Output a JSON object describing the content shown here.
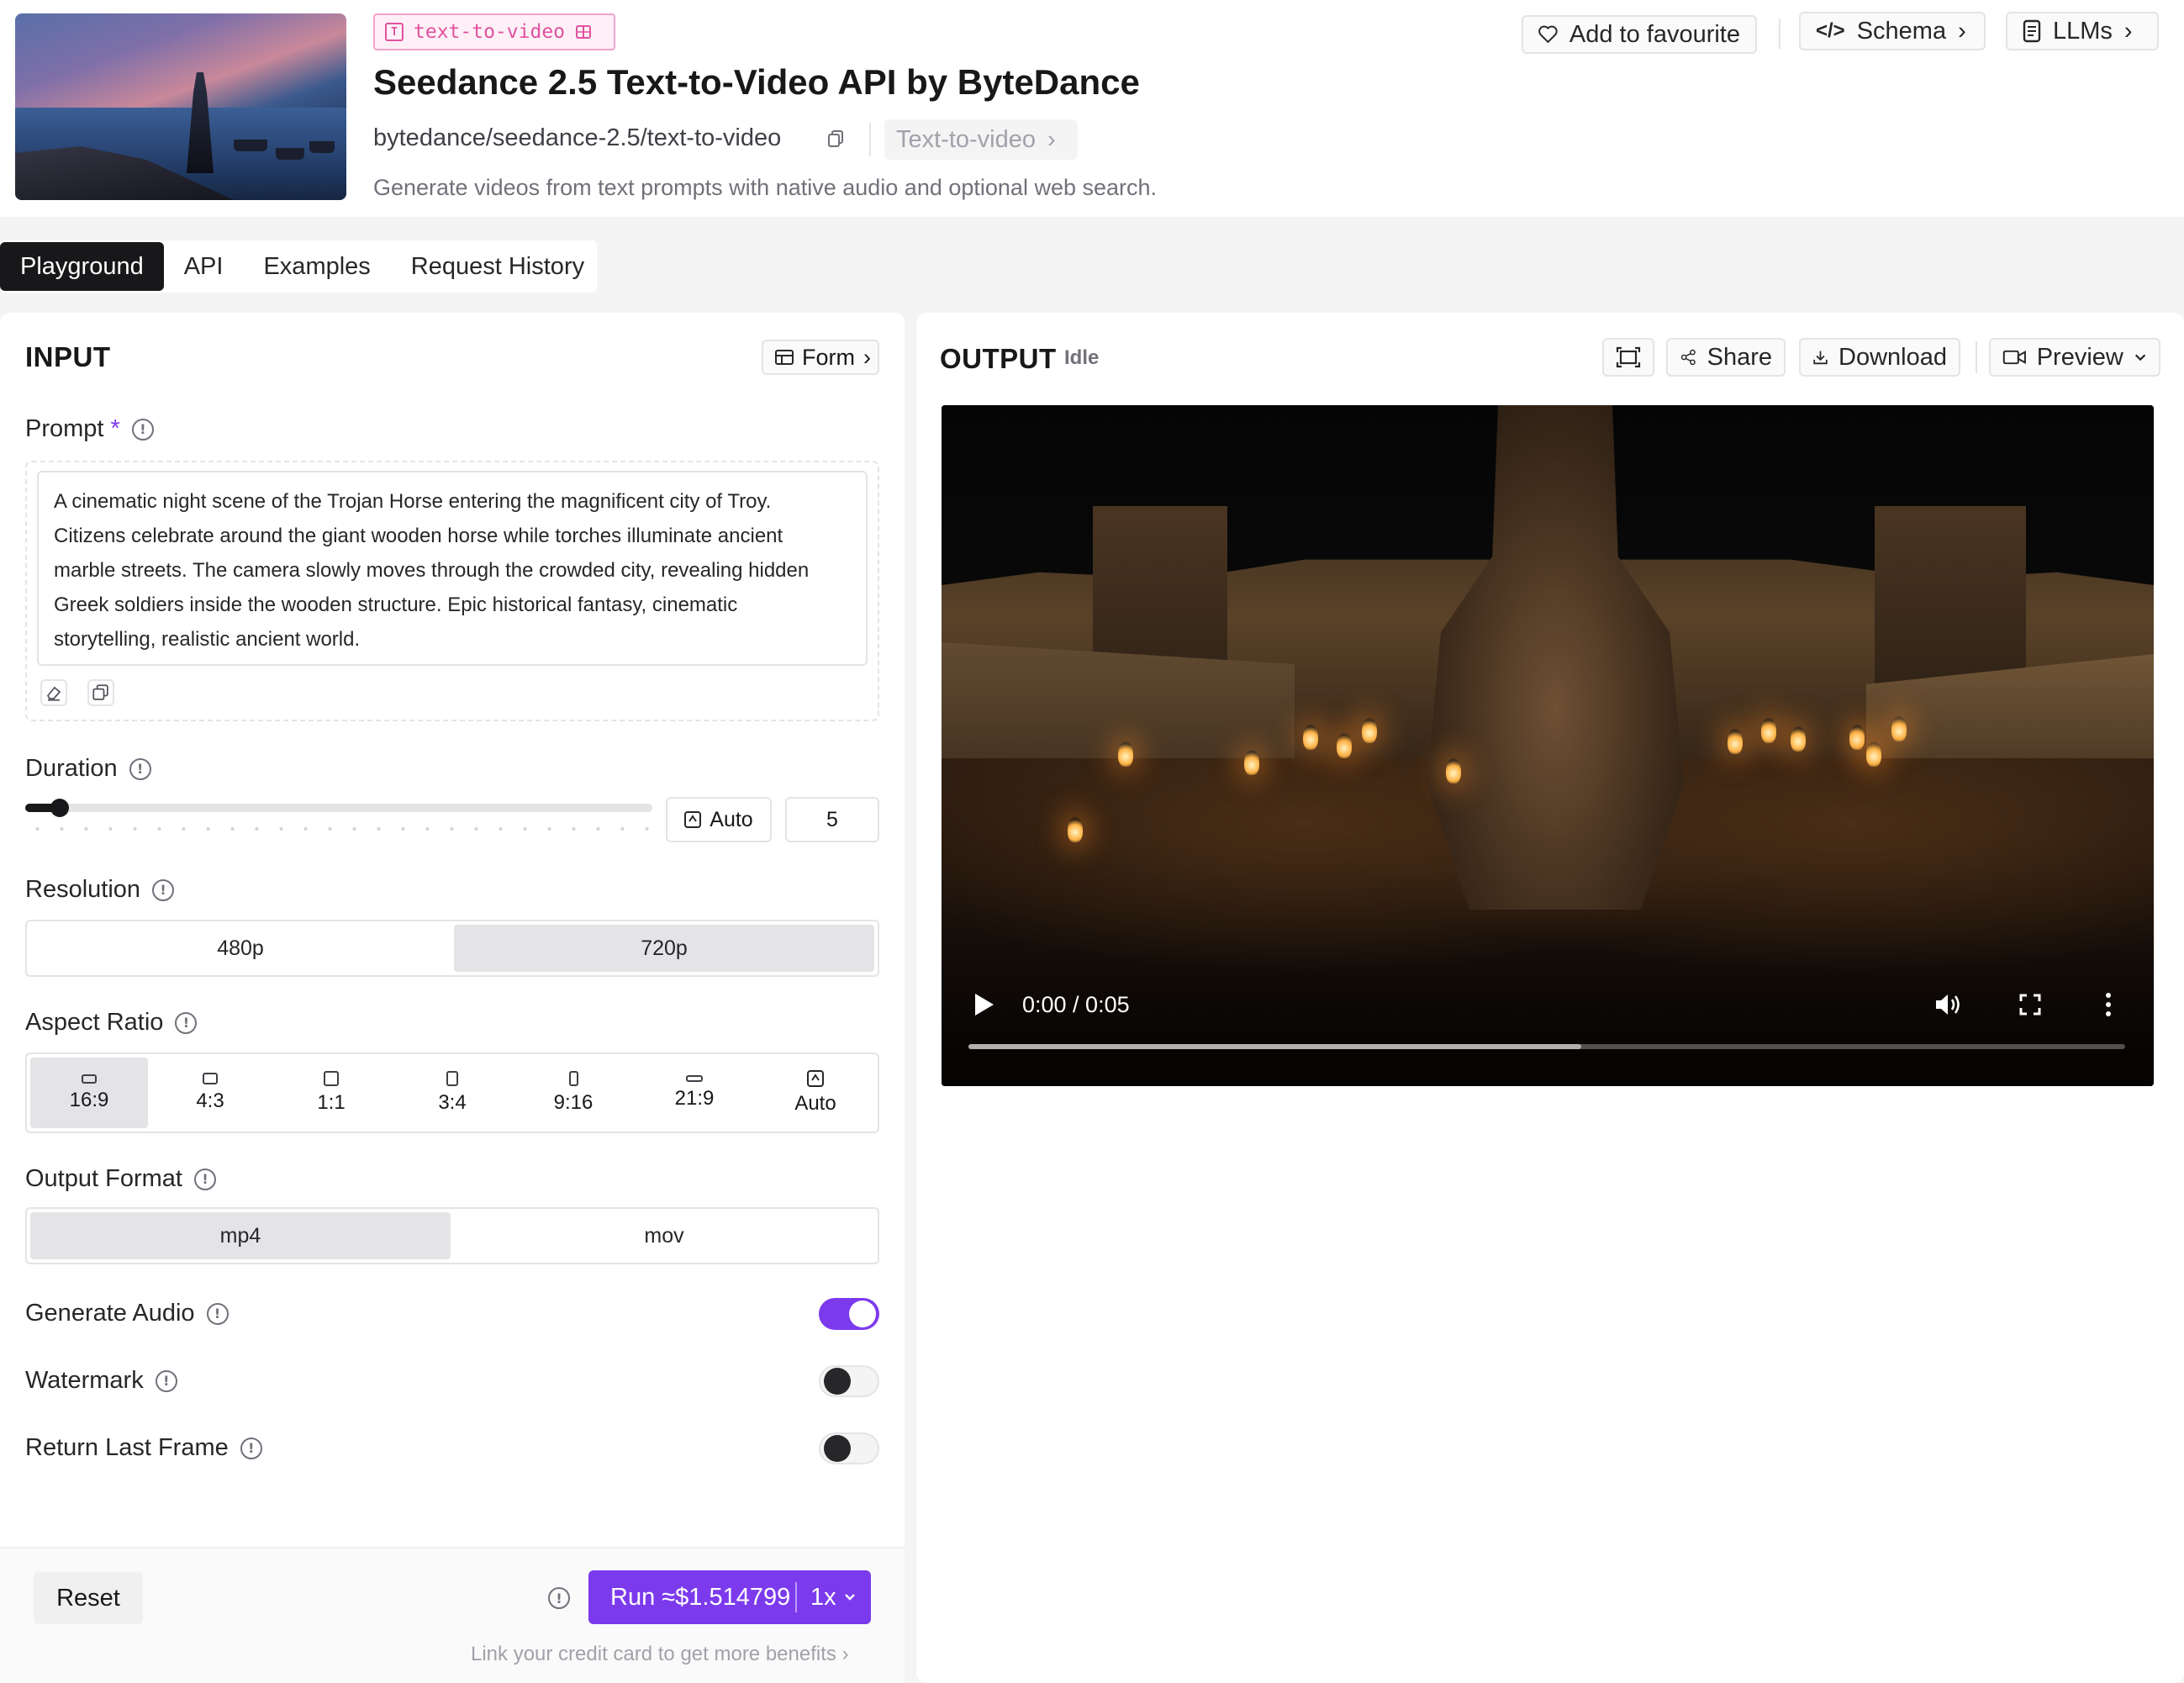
{
  "header": {
    "tag": "text-to-video",
    "title": "Seedance 2.5 Text-to-Video API by ByteDance",
    "model_id": "bytedance/seedance-2.5/text-to-video",
    "category": "Text-to-video",
    "description": "Generate videos from text prompts with native audio and optional web search.",
    "favourite_label": "Add to favourite",
    "schema_label": "Schema",
    "llms_label": "LLMs"
  },
  "tabs": [
    {
      "label": "Playground",
      "active": true
    },
    {
      "label": "API",
      "active": false
    },
    {
      "label": "Examples",
      "active": false
    },
    {
      "label": "Request History",
      "active": false
    }
  ],
  "input": {
    "title": "INPUT",
    "form_label": "Form",
    "prompt": {
      "label": "Prompt",
      "required_mark": "*",
      "lines": [
        "A cinematic night scene of the Trojan Horse entering the magnificent city of Troy.",
        "Citizens celebrate around the giant wooden horse while torches illuminate ancient",
        "marble streets. The camera slowly moves through the crowded city, revealing hidden",
        "Greek soldiers inside the wooden structure. Epic historical fantasy, cinematic",
        "storytelling, realistic ancient world."
      ]
    },
    "duration": {
      "label": "Duration",
      "auto_label": "Auto",
      "value": "5",
      "slider_fraction": 0.04
    },
    "resolution": {
      "label": "Resolution",
      "options": [
        "480p",
        "720p"
      ],
      "selected": "720p"
    },
    "aspect_ratio": {
      "label": "Aspect Ratio",
      "options": [
        "16:9",
        "4:3",
        "1:1",
        "3:4",
        "9:16",
        "21:9",
        "Auto"
      ],
      "selected": "16:9"
    },
    "output_format": {
      "label": "Output Format",
      "options": [
        "mp4",
        "mov"
      ],
      "selected": "mp4"
    },
    "generate_audio": {
      "label": "Generate Audio",
      "on": true
    },
    "watermark": {
      "label": "Watermark",
      "on": false
    },
    "return_last_frame": {
      "label": "Return Last Frame",
      "on": false
    },
    "footer": {
      "reset_label": "Reset",
      "run_label": "Run ≈$1.514799",
      "multiplier": "1x",
      "credit_link": "Link your credit card to get more benefits"
    }
  },
  "output": {
    "title": "OUTPUT",
    "status": "Idle",
    "share_label": "Share",
    "download_label": "Download",
    "preview_label": "Preview",
    "video": {
      "time": "0:00 / 0:05",
      "buffered_fraction": 0.53
    }
  },
  "colors": {
    "accent": "#7c3aed",
    "tag_pink": "#e0529e",
    "dark": "#18181b"
  }
}
